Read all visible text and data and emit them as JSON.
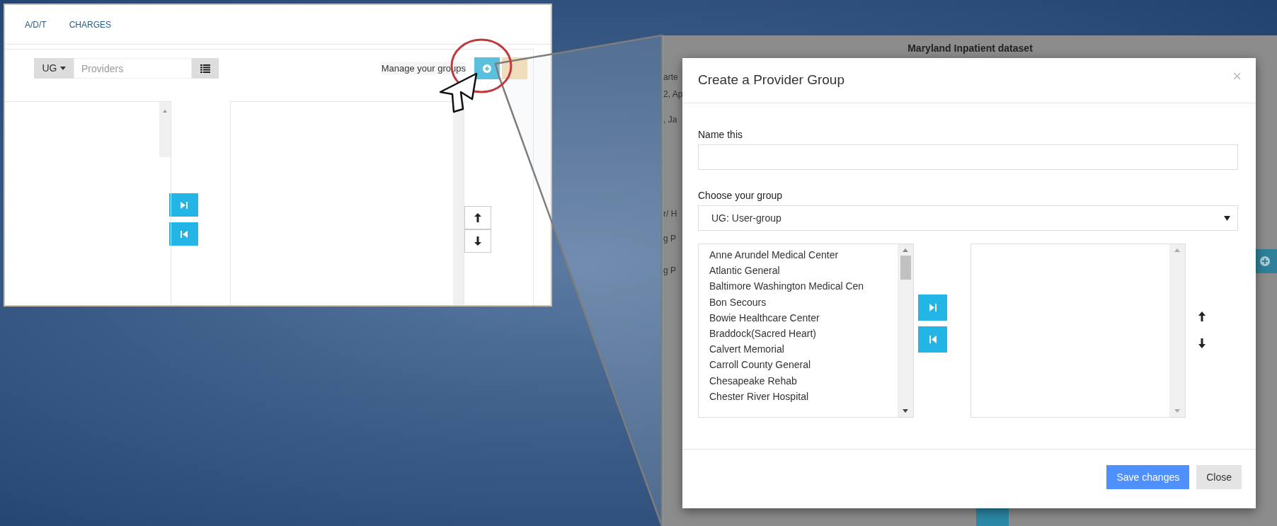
{
  "left_screenshot": {
    "tabs": [
      {
        "label": "A/D/T"
      },
      {
        "label": "CHARGES"
      }
    ],
    "group_prefix": "UG",
    "search": {
      "placeholder": "Providers"
    },
    "manage_label": "Manage your groups"
  },
  "right_screenshot": {
    "page_title": "Maryland Inpatient dataset",
    "background_fragments": [
      "arte",
      "2, Ap",
      ", Ja",
      "r/ H",
      "g P",
      "g P"
    ],
    "modal": {
      "title": "Create a Provider Group",
      "close_symbol": "×",
      "name_label": "Name this",
      "group_label": "Choose your group",
      "group_value": "UG: User-group",
      "providers": [
        "Anne Arundel Medical Center",
        "Atlantic General",
        "Baltimore Washington Medical Cen",
        "Bon Secours",
        "Bowie Healthcare Center",
        "Braddock(Sacred Heart)",
        "Calvert Memorial",
        "Carroll County General",
        "Chesapeake Rehab",
        "Chester River Hospital"
      ],
      "buttons": [
        {
          "label": "Save changes",
          "kind": "primary"
        },
        {
          "label": "Close",
          "kind": "secondary"
        }
      ]
    }
  }
}
